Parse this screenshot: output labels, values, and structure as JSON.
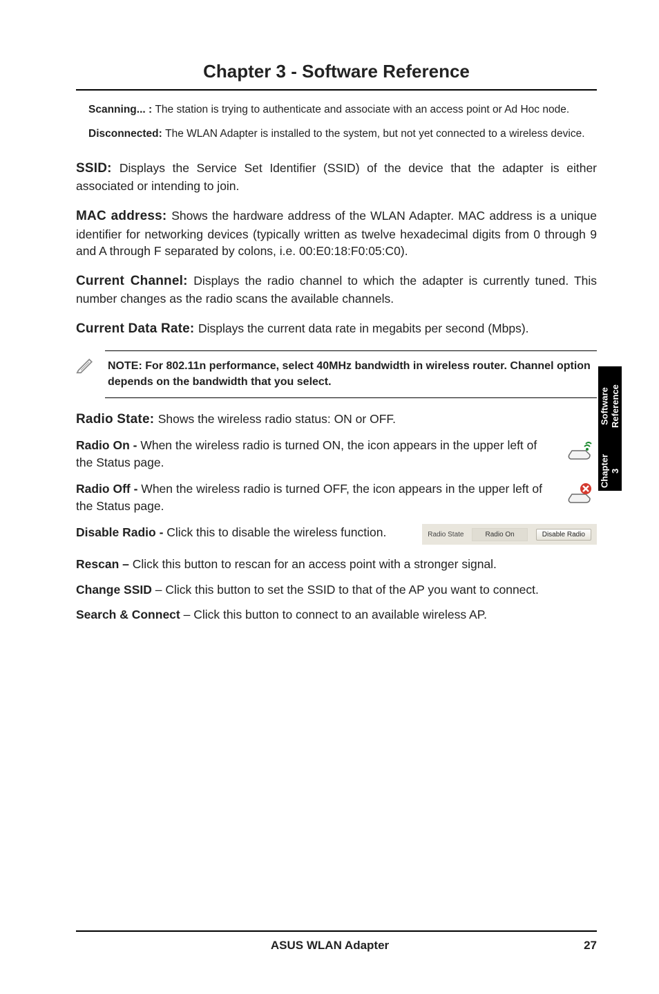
{
  "header": {
    "chapter_title": "Chapter 3 - Software Reference"
  },
  "sidetab": {
    "line1": "Chapter 3",
    "line2": "Software Reference"
  },
  "scanning": {
    "lead": "Scanning... : ",
    "body": "The station is trying to authenticate and associate with an access point or Ad Hoc node."
  },
  "disconnected": {
    "lead": "Disconnected: ",
    "body": "The WLAN Adapter is installed to the system, but not yet connected to a wireless device."
  },
  "ssid": {
    "lead": "SSID: ",
    "body": "Displays the Service Set Identifier (SSID) of the device that the adapter is either associated or intending to join."
  },
  "mac": {
    "lead": "MAC address: ",
    "body": "Shows the hardware address of the WLAN Adapter. MAC address is a unique identifier for networking devices (typically written as twelve hexadecimal digits from 0 through 9 and A through F separated by colons, i.e. 00:E0:18:F0:05:C0)."
  },
  "channel": {
    "lead": "Current Channel: ",
    "body": "Displays the radio channel to which the adapter is currently tuned. This number changes as the radio scans the available channels."
  },
  "rate": {
    "lead": "Current Data Rate: ",
    "body": "Displays the current data rate in megabits per second (Mbps)."
  },
  "note": {
    "text": "NOTE: For 802.11n performance, select 40MHz bandwidth in wireless router. Channel option depends on the bandwidth that you select."
  },
  "radiostate": {
    "lead": "Radio State: ",
    "body": "Shows the wireless radio status: ON or OFF."
  },
  "radio_on": {
    "lead": "Radio On - ",
    "body": "When the wireless radio is turned ON, the icon appears in the upper left of the Status page."
  },
  "radio_off": {
    "lead": "Radio Off - ",
    "body": "When the wireless radio is turned OFF, the icon appears in the upper left of the Status page."
  },
  "disable": {
    "lead": "Disable Radio - ",
    "body": "Click this to disable the wireless function."
  },
  "radio_ui": {
    "label": "Radio State",
    "value": "Radio On",
    "button": "Disable Radio"
  },
  "rescan": {
    "lead": "Rescan – ",
    "body": "Click this button to rescan for an access point with a stronger signal."
  },
  "change_ssid": {
    "lead": "Change SSID",
    "body": " – Click this button to set the SSID to that of the AP you want to connect."
  },
  "search_connect": {
    "lead": "Search & Connect",
    "body": " – Click this button to connect to an available wireless AP."
  },
  "footer": {
    "product": "ASUS WLAN Adapter",
    "page": "27"
  }
}
